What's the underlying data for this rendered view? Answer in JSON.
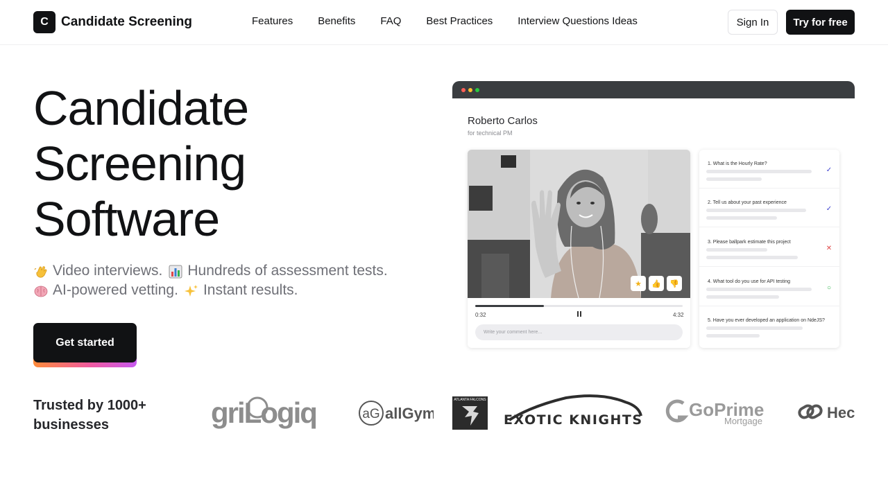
{
  "header": {
    "brand_initial": "C",
    "brand_name": "Candidate Screening",
    "nav": [
      "Features",
      "Benefits",
      "FAQ",
      "Best Practices",
      "Interview Questions Ideas"
    ],
    "sign_in": "Sign In",
    "try_free": "Try for free"
  },
  "hero": {
    "title_lines": [
      "Candidate",
      "Screening",
      "Software"
    ],
    "sub1": [
      {
        "icon": "waving-hand-icon",
        "text": "Video interviews."
      },
      {
        "icon": "bar-chart-icon",
        "text": "Hundreds of assessment tests."
      }
    ],
    "sub2": [
      {
        "icon": "brain-icon",
        "text": "AI-powered vetting."
      },
      {
        "icon": "sparkles-icon",
        "text": "Instant results."
      }
    ],
    "cta": "Get started"
  },
  "mock": {
    "candidate_name": "Roberto Carlos",
    "candidate_role": "for technical PM",
    "player": {
      "current": "0:32",
      "total": "4:32",
      "progress": 0.33
    },
    "comment_placeholder": "Write your comment here...",
    "questions": [
      {
        "text": "1. What is the Hourly Rate?",
        "status": "check"
      },
      {
        "text": "2. Tell us about your past experience",
        "status": "check"
      },
      {
        "text": "3. Please ballpark estimate this project",
        "status": "cross"
      },
      {
        "text": "4. What tool do you use for API testing",
        "status": "pending"
      },
      {
        "text": "5. Have you ever developed an application on NdeJS?",
        "status": "none"
      }
    ],
    "colors": {
      "check": "#3b3fcf",
      "cross": "#e04848",
      "pending": "#2fb44a"
    }
  },
  "trusted": {
    "heading": "Trusted by 1000+ businesses",
    "logos": [
      {
        "name": "agrilogiq-logo",
        "text": "griLogiq"
      },
      {
        "name": "allgym-logo",
        "text": "allGym",
        "mark": "aG"
      },
      {
        "name": "atlanta-falcons-logo",
        "text": "ATLANTA FALCONS"
      },
      {
        "name": "exotic-knights-logo",
        "text": "EXOTIC KNIGHTS"
      },
      {
        "name": "goprime-mortgage-logo",
        "text": "GoPrime",
        "sub": "Mortgage"
      },
      {
        "name": "hec-logo",
        "text": "Hec"
      }
    ]
  }
}
